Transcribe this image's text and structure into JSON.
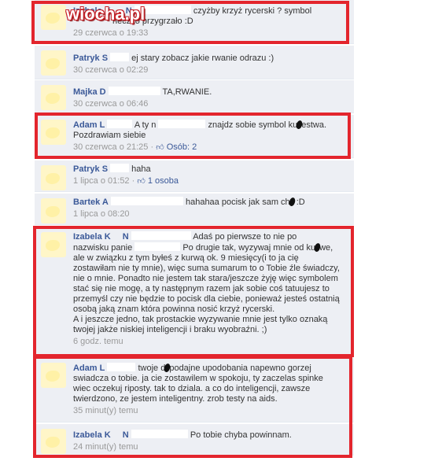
{
  "watermark": "wiocha.pl",
  "comments": [
    {
      "author": "Izabela K",
      "author_2": "N",
      "text_1": "czyżby krzyż rycerski ? symbol",
      "text_2": "neczko przygrzało :D",
      "time": "29 czerwca o 19:33"
    },
    {
      "author": "Patryk S",
      "text_1": "ej stary zobacz jakie rwanie odrazu :)",
      "time": "30 czerwca o 02:29"
    },
    {
      "author": "Majka D",
      "text_1": "TA,RWANIE.",
      "time": "30 czerwca o 06:46"
    },
    {
      "author": "Adam L",
      "text_a": "A ty n",
      "text_b": "znajdz sobie symbol ku",
      "text_c": "estwa.",
      "text_2": "Pozdrawiam siebie",
      "time": "30 czerwca o 21:25",
      "likes": "Osób: 2"
    },
    {
      "author": "Patryk S",
      "text_1": "haha",
      "time": "1 lipca o 01:52",
      "likes": "1 osoba"
    },
    {
      "author": "Bartek A",
      "text_a": "hahahaa pocisk jak sam ch",
      "text_b": ":D",
      "time": "1 lipca o 08:20"
    },
    {
      "author": "Izabela K",
      "author_2": "N",
      "lines": [
        "Adaś po pierwsze to nie po",
        "Po drugie tak, wyzywaj mnie od ku",
        "ale w związku z tym byłeś z kurwą ok. 9 miesięcy(i to ja cię",
        "zostawiłam nie ty mnie), więc suma sumarum to o Tobie źle świadczy,",
        "nie o mnie. Ponadto nie jestem tak stara/jeszcze żyję więc symbolem",
        "stać się nie mogę, a ty następnym razem jak sobie coś tatuujesz to",
        "przemyśl czy nie będzie to pocisk dla ciebie, ponieważ jesteś ostatnią",
        "osobą jaką znam która powinna nosić krzyż rycerski.",
        "A i jeszcze jedno, tak prostackie wyzywanie mnie jest tylko oznaką",
        "twojej jakże niskiej inteligencji i braku wyobraźni. ;)"
      ],
      "line1_prefix": "nazwisku panie",
      "line2_tail": "we,",
      "time": "6 godz. temu"
    },
    {
      "author": "Adam L",
      "line_1a": "twoje d",
      "line_1b": "podajne upodobania napewno gorzej",
      "lines": [
        "swiadcza o tobie. ja cie zostawilem w spokoju, ty zaczelas spinke",
        "wiec oczekuj riposty. tak to dziala. a co do inteligencji, zawsze",
        "twierdzono, ze jestem inteligentny. zrob testy na aids."
      ],
      "time": "35 minut(y) temu"
    },
    {
      "author": "Izabela K",
      "author_2": "N",
      "text_1": "Po tobie chyba powinnam.",
      "time": "24 minut(y) temu"
    }
  ]
}
